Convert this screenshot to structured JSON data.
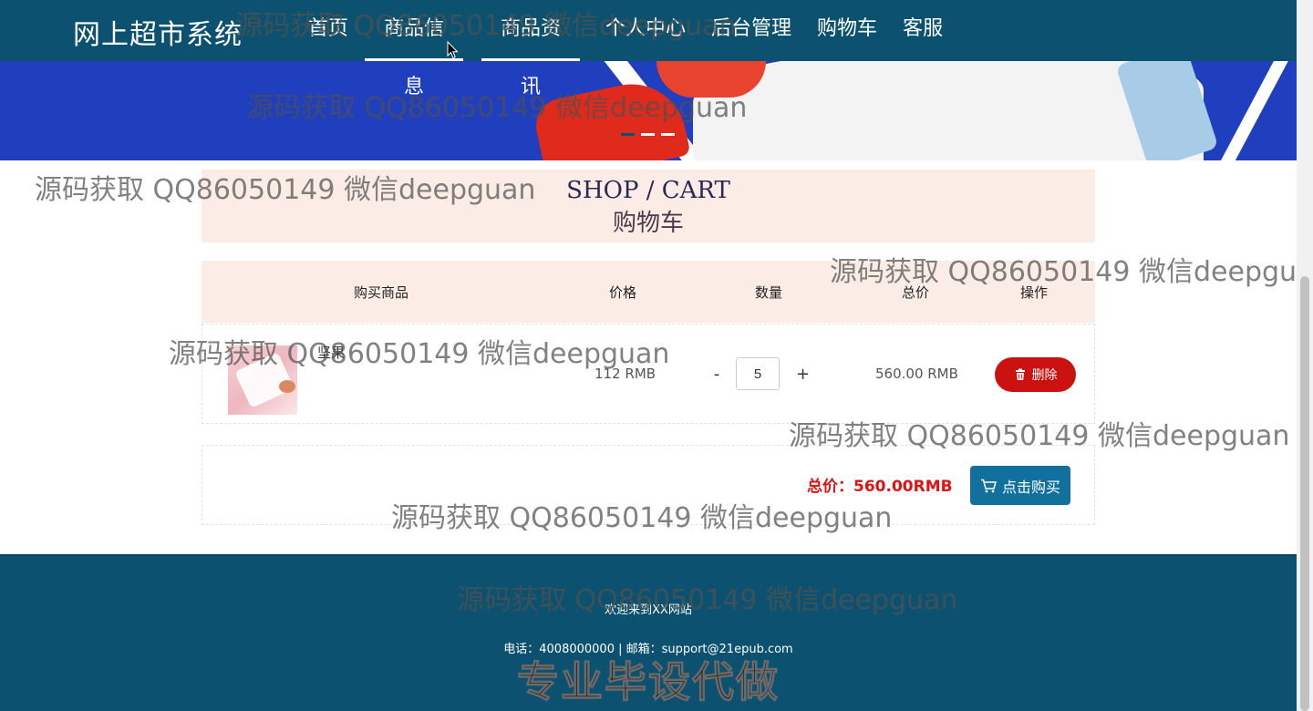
{
  "header": {
    "brand": "网上超市系统",
    "nav": [
      "首页",
      "商品信息",
      "商品资讯",
      "个人中心",
      "后台管理",
      "购物车",
      "客服"
    ]
  },
  "title": {
    "en": "SHOP / CART",
    "cn": "购物车"
  },
  "table": {
    "columns": [
      "购买商品",
      "价格",
      "数量",
      "总价",
      "操作"
    ],
    "rows": [
      {
        "name": "坚果",
        "price": "112 RMB",
        "qty": "5",
        "minus": "-",
        "plus": "+",
        "total": "560.00 RMB",
        "delete": "删除"
      }
    ]
  },
  "summary": {
    "total": "总价：560.00RMB",
    "buy": "点击购买"
  },
  "footer": {
    "welcome": "欢迎来到XX网站",
    "contact": "电话：4008000000 | 邮箱：support@21epub.com",
    "promo": "专业毕设代做"
  },
  "watermark": "源码获取 QQ86050149 微信deepguan",
  "colors": {
    "primary": "#0c5270",
    "danger": "#cc1111",
    "buy": "#11709c",
    "panel": "#fbede6"
  }
}
